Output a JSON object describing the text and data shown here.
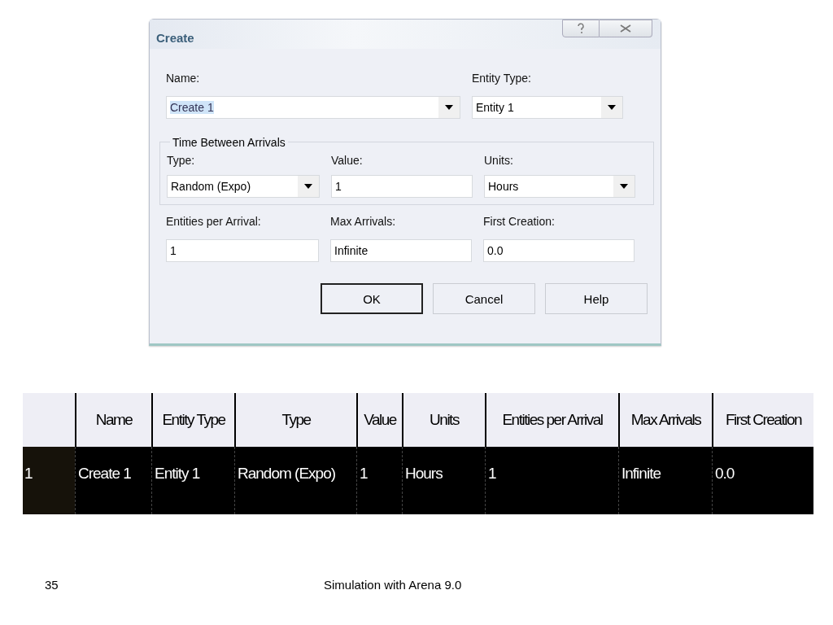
{
  "dialog": {
    "title": "Create",
    "top_fields": [
      {
        "label": "Name:",
        "value": "Create 1",
        "kind": "combo",
        "highlighted": true
      },
      {
        "label": "Entity Type:",
        "value": "Entity 1",
        "kind": "combo",
        "highlighted": false
      }
    ],
    "group": {
      "title": "Time Between Arrivals",
      "fields": [
        {
          "label": "Type:",
          "value": "Random (Expo)",
          "kind": "combo",
          "highlighted": false
        },
        {
          "label": "Value:",
          "value": "1",
          "kind": "text",
          "highlighted": false
        },
        {
          "label": "Units:",
          "value": "Hours",
          "kind": "combo",
          "highlighted": false
        }
      ]
    },
    "bottom_fields": [
      {
        "label": "Entities per Arrival:",
        "value": "1",
        "kind": "text",
        "highlighted": false
      },
      {
        "label": "Max Arrivals:",
        "value": "Infinite",
        "kind": "text",
        "highlighted": false
      },
      {
        "label": "First Creation:",
        "value": "0.0",
        "kind": "text",
        "highlighted": false
      }
    ],
    "buttons": [
      {
        "label": "OK",
        "default": true
      },
      {
        "label": "Cancel",
        "default": false
      },
      {
        "label": "Help",
        "default": false
      }
    ]
  },
  "table": {
    "columns": [
      "",
      "Name",
      "Entity Type",
      "Type",
      "Value",
      "Units",
      "Entities per Arrival",
      "Max Arrivals",
      "First Creation"
    ],
    "rows": [
      {
        "cells": [
          "1",
          "Create 1",
          "Entity 1",
          "Random (Expo)",
          "1",
          "Hours",
          "1",
          "Infinite",
          "0.0"
        ]
      }
    ]
  },
  "footer": {
    "page_number": "35",
    "title": "Simulation with Arena 9.0"
  }
}
